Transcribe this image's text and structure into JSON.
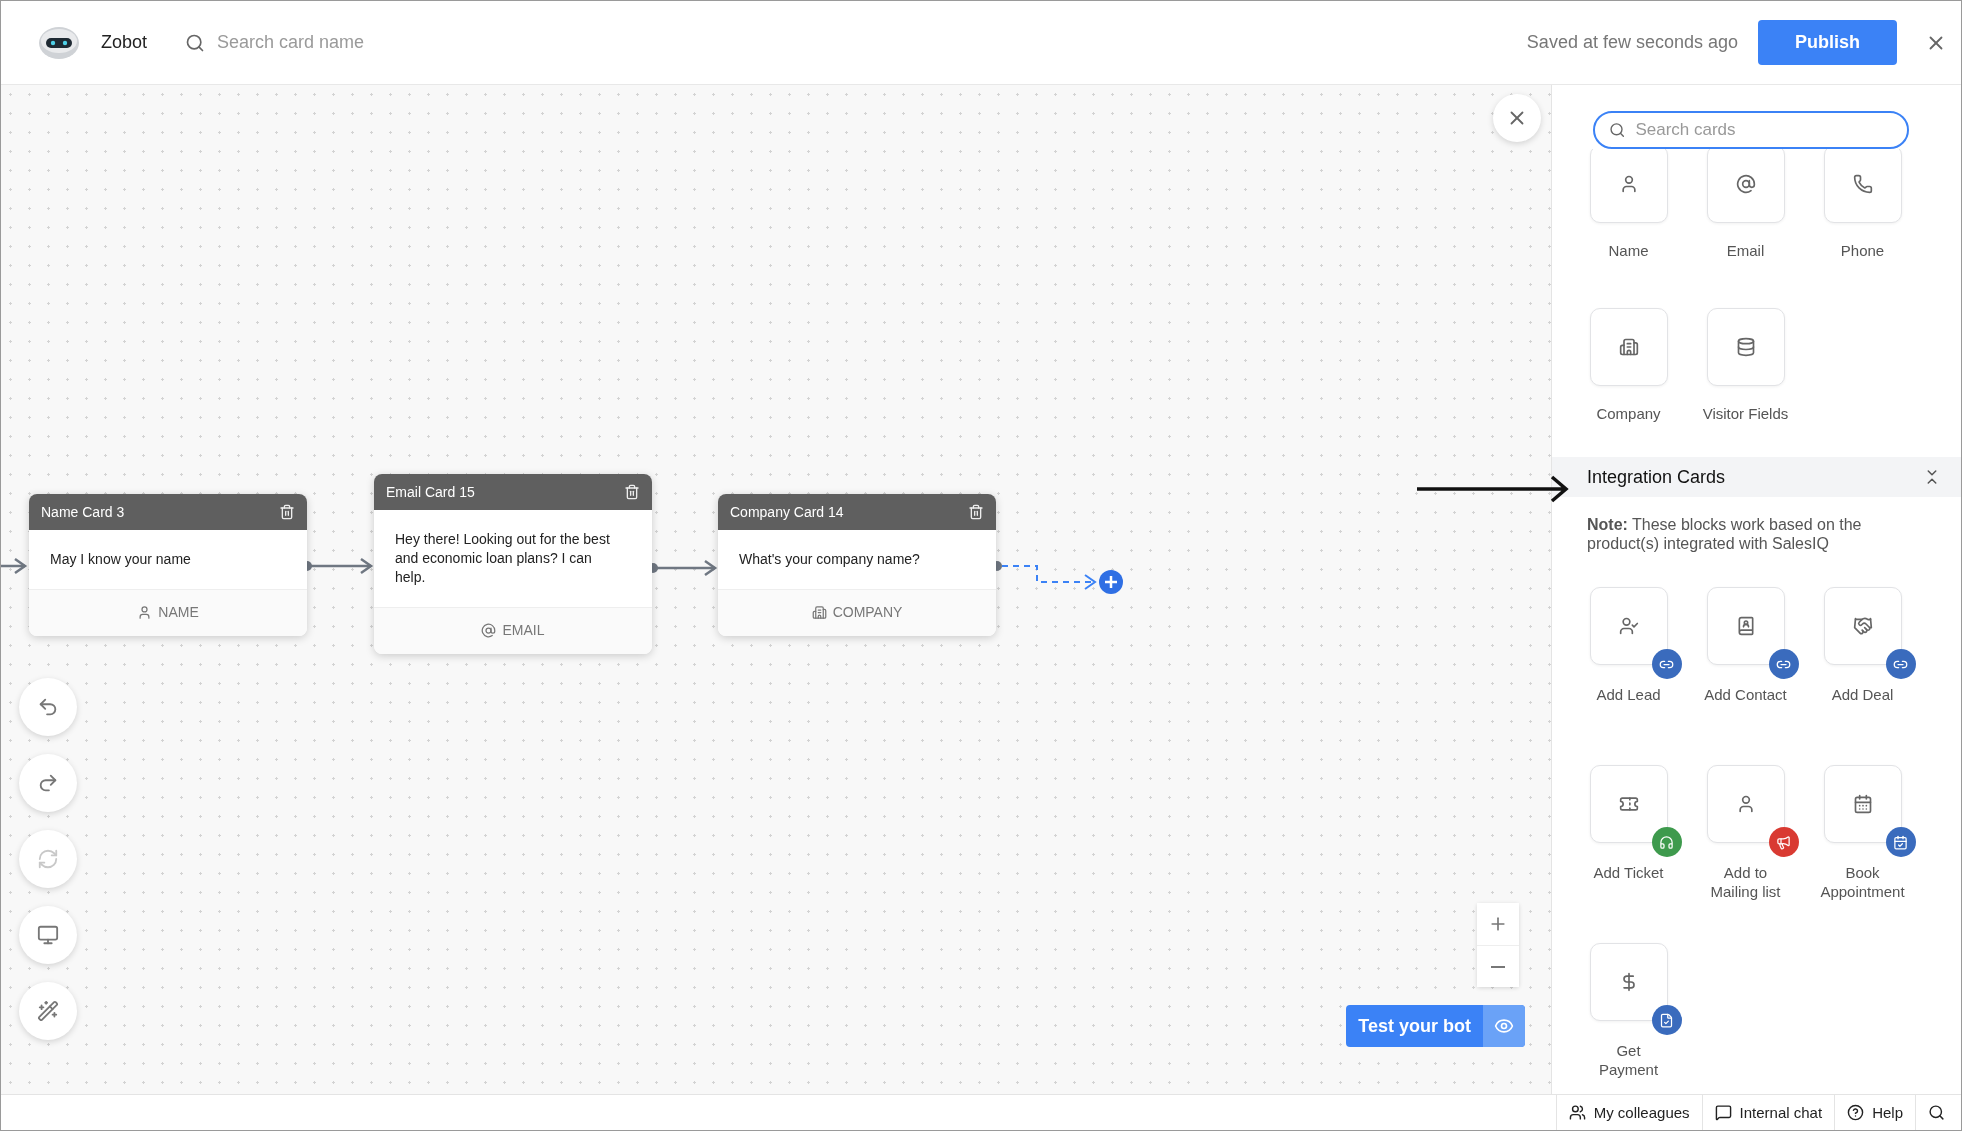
{
  "app": {
    "name": "Zobot"
  },
  "header": {
    "search_placeholder": "Search card name",
    "save_status": "Saved at few seconds ago",
    "publish": "Publish"
  },
  "flow_cards": [
    {
      "title": "Name Card 3",
      "message": "May I know your name",
      "field": "NAME",
      "kind": "name"
    },
    {
      "title": "Email Card 15",
      "message": "Hey there! Looking out for the best and economic loan plans? I can help.",
      "field": "EMAIL",
      "kind": "email"
    },
    {
      "title": "Company Card 14",
      "message": "What's your company name?",
      "field": "COMPANY",
      "kind": "company"
    }
  ],
  "tools": [
    {
      "kind": "undo",
      "disabled": false
    },
    {
      "kind": "redo",
      "disabled": false
    },
    {
      "kind": "refresh",
      "disabled": true
    },
    {
      "kind": "preview",
      "disabled": false
    },
    {
      "kind": "magic",
      "disabled": false
    }
  ],
  "test_button": "Test your bot",
  "panel": {
    "search_placeholder": "Search cards",
    "cards": [
      {
        "label": "Name",
        "kind": "name"
      },
      {
        "label": "Email",
        "kind": "email"
      },
      {
        "label": "Phone",
        "kind": "phone"
      },
      {
        "label": "Company",
        "kind": "company"
      },
      {
        "label": "Visitor Fields",
        "kind": "fields"
      }
    ],
    "section": {
      "title": "Integration Cards",
      "note": "**Note:**  These blocks work based on the product(s) integrated with SalesIQ",
      "cards": [
        {
          "label": "Add Lead",
          "kind": "lead",
          "color": "#3a6bbd"
        },
        {
          "label": "Add Contact",
          "kind": "contact",
          "color": "#3a6bbd"
        },
        {
          "label": "Add Deal",
          "kind": "deal",
          "color": "#3a6bbd"
        },
        {
          "label": "Add Ticket",
          "kind": "ticket",
          "color": "#3e9a4d"
        },
        {
          "label": "Add to Mailing list",
          "kind": "mailing",
          "color": "#d93a32"
        },
        {
          "label": "Book Appointment",
          "kind": "appointment",
          "color": "#3a6bbd"
        },
        {
          "label": "Get Payment",
          "kind": "payment",
          "color": "#3a6bbd"
        }
      ]
    }
  },
  "status_bar": [
    {
      "label": "My colleagues",
      "kind": "colleagues"
    },
    {
      "label": "Internal chat",
      "kind": "chat"
    },
    {
      "label": "Help",
      "kind": "help"
    },
    {
      "kind": "search"
    }
  ]
}
